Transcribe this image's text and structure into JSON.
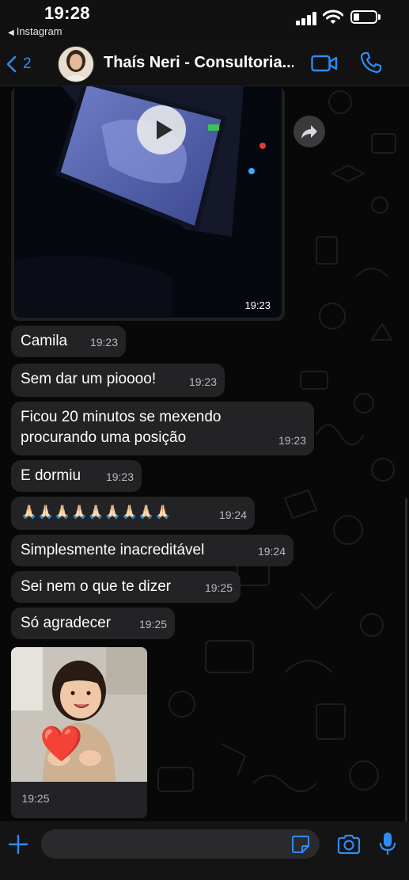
{
  "status_bar": {
    "time": "19:28",
    "back_app": "Instagram"
  },
  "header": {
    "back_count": "2",
    "contact_name": "Thaís Neri - Consultoria..."
  },
  "colors": {
    "accent": "#2f8cf5",
    "bubble": "#232325",
    "background": "#0b0b0b"
  },
  "video_message": {
    "time": "19:23"
  },
  "messages": [
    {
      "text": "Camila",
      "time": "19:23"
    },
    {
      "text": "Sem dar um pioooo!",
      "time": "19:23"
    },
    {
      "text": "Ficou 20 minutos se mexendo procurando uma posição",
      "time": "19:23"
    },
    {
      "text": "E dormiu",
      "time": "19:23"
    },
    {
      "text": "🙏🏻🙏🏻🙏🏻🙏🏻🙏🏻🙏🏻🙏🏻🙏🏻🙏🏻",
      "time": "19:24"
    },
    {
      "text": "Simplesmente inacreditável",
      "time": "19:24"
    },
    {
      "text": "Sei nem o que te dizer",
      "time": "19:25"
    },
    {
      "text": "Só agradecer",
      "time": "19:25"
    }
  ],
  "photo_message": {
    "time": "19:25",
    "sticker": "❤️"
  },
  "icons": [
    "back-chevron-icon",
    "video-call-icon",
    "phone-icon",
    "play-icon",
    "forward-icon",
    "plus-icon",
    "sticker-icon",
    "camera-icon",
    "microphone-icon"
  ]
}
